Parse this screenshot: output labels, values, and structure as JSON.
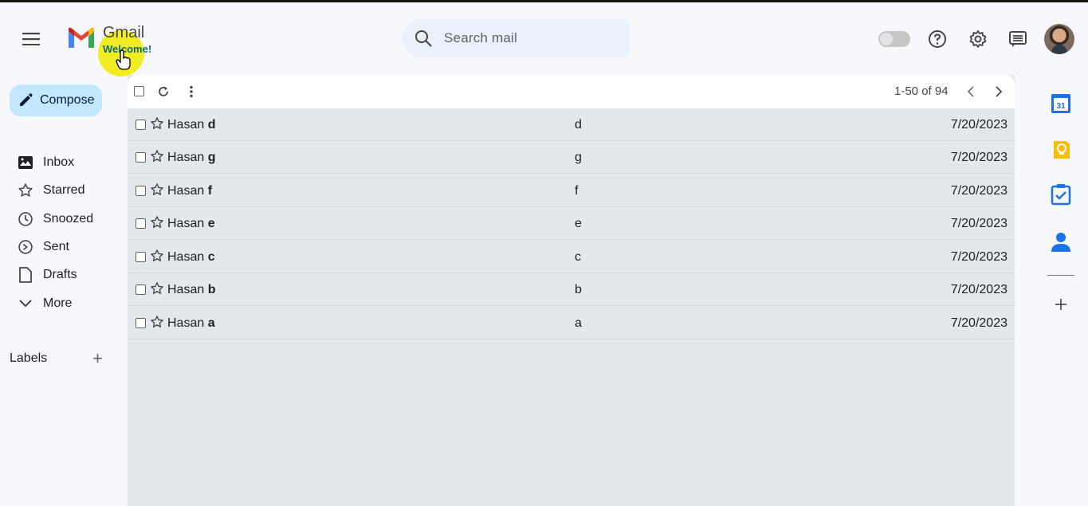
{
  "app": {
    "brand": "Gmail",
    "welcome": "Welcome!"
  },
  "search": {
    "placeholder": "Search mail"
  },
  "nav": {
    "compose_label": "Compose",
    "items": [
      {
        "label": "Inbox",
        "icon": "inbox-icon"
      },
      {
        "label": "Starred",
        "icon": "star-icon"
      },
      {
        "label": "Snoozed",
        "icon": "clock-icon"
      },
      {
        "label": "Sent",
        "icon": "send-icon"
      },
      {
        "label": "Drafts",
        "icon": "draft-icon"
      },
      {
        "label": "More",
        "icon": "chevron-down-icon"
      }
    ],
    "labels_title": "Labels"
  },
  "toolbar": {
    "pagination": "1-50 of 94"
  },
  "emails": [
    {
      "sender": "Hasan",
      "sender_bold": "d",
      "subject": "d",
      "date": "7/20/2023"
    },
    {
      "sender": "Hasan",
      "sender_bold": "g",
      "subject": "g",
      "date": "7/20/2023"
    },
    {
      "sender": "Hasan",
      "sender_bold": "f",
      "subject": "f",
      "date": "7/20/2023"
    },
    {
      "sender": "Hasan",
      "sender_bold": "e",
      "subject": "e",
      "date": "7/20/2023"
    },
    {
      "sender": "Hasan",
      "sender_bold": "c",
      "subject": "c",
      "date": "7/20/2023"
    },
    {
      "sender": "Hasan",
      "sender_bold": "b",
      "subject": "b",
      "date": "7/20/2023"
    },
    {
      "sender": "Hasan",
      "sender_bold": "a",
      "subject": "a",
      "date": "7/20/2023"
    }
  ],
  "right_rail": {
    "calendar_day": "31"
  },
  "colors": {
    "compose_bg": "#c2e7ff",
    "highlight": "#f1ec17",
    "list_bg": "#e4e8ed",
    "background": "#f6f8fc"
  }
}
